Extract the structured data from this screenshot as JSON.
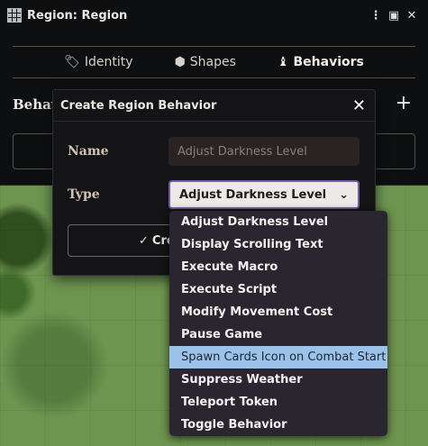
{
  "window": {
    "title": "Region: Region",
    "menu_icon": "kebab-menu-icon",
    "extra_icon": "token-icon"
  },
  "tabs": [
    {
      "label": "Identity",
      "icon": "tag-icon"
    },
    {
      "label": "Shapes",
      "icon": "shapes-icon"
    },
    {
      "label": "Behaviors",
      "icon": "chess-icon",
      "active": true
    }
  ],
  "section": {
    "label": "Behav",
    "add_icon": "plus-icon"
  },
  "dialog": {
    "title": "Create Region Behavior",
    "close_icon": "close-icon",
    "name_label": "Name",
    "name_placeholder": "Adjust Darkness Level",
    "type_label": "Type",
    "type_value": "Adjust Darkness Level",
    "create_label": "Cre"
  },
  "dropdown": {
    "options": [
      "Adjust Darkness Level",
      "Display Scrolling Text",
      "Execute Macro",
      "Execute Script",
      "Modify Movement Cost",
      "Pause Game",
      "Spawn Cards Icon on Combat Start",
      "Suppress Weather",
      "Teleport Token",
      "Toggle Behavior"
    ],
    "highlighted_index": 6
  },
  "colors": {
    "accent": "#6d5fa4",
    "highlight": "#9bc3e9",
    "map_green": "#6e9550"
  }
}
